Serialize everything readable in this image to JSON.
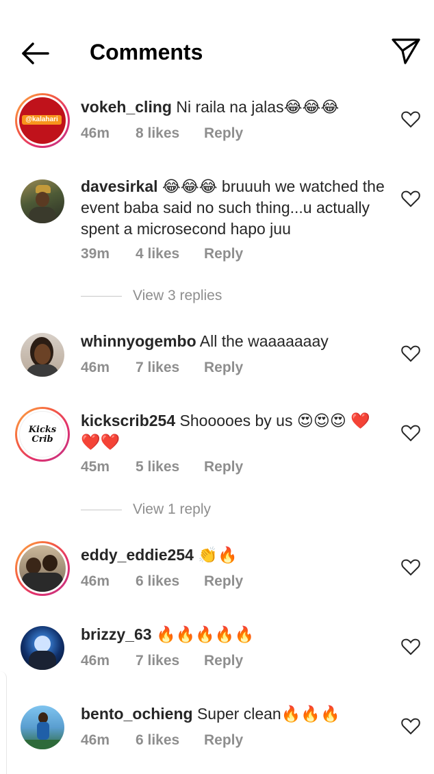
{
  "header": {
    "title": "Comments"
  },
  "comments": [
    {
      "username": "vokeh_cling",
      "text": "Ni raila na jalas😂😂😂",
      "time": "46m",
      "likes": "8 likes",
      "reply_label": "Reply",
      "avatar_text": "@kalahari"
    },
    {
      "username": "davesirkal",
      "text": "😂😂😂 bruuuh we watched the event baba said no such thing...u actually spent a microsecond hapo juu",
      "time": "39m",
      "likes": "4 likes",
      "reply_label": "Reply",
      "view_replies": "View 3 replies"
    },
    {
      "username": "whinnyogembo",
      "text": "All the waaaaaaay",
      "time": "46m",
      "likes": "7 likes",
      "reply_label": "Reply"
    },
    {
      "username": "kickscrib254",
      "text": "Shooooes by us 😍😍😍 ❤️❤️❤️",
      "time": "45m",
      "likes": "5 likes",
      "reply_label": "Reply",
      "view_replies": "View 1 reply",
      "avatar_text": "Kicks Crib"
    },
    {
      "username": "eddy_eddie254",
      "text": "👏🔥",
      "time": "46m",
      "likes": "6 likes",
      "reply_label": "Reply"
    },
    {
      "username": "brizzy_63",
      "text": "🔥🔥🔥🔥🔥",
      "time": "46m",
      "likes": "7 likes",
      "reply_label": "Reply"
    },
    {
      "username": "bento_ochieng",
      "text": "Super clean🔥🔥🔥",
      "time": "46m",
      "likes": "6 likes",
      "reply_label": "Reply"
    }
  ],
  "icons": {
    "back": "arrow-left-icon",
    "send": "paper-plane-icon",
    "like": "heart-outline-icon"
  },
  "colors": {
    "text": "#262626",
    "muted": "#8e8e8e",
    "story_ring": "#e1306c"
  }
}
